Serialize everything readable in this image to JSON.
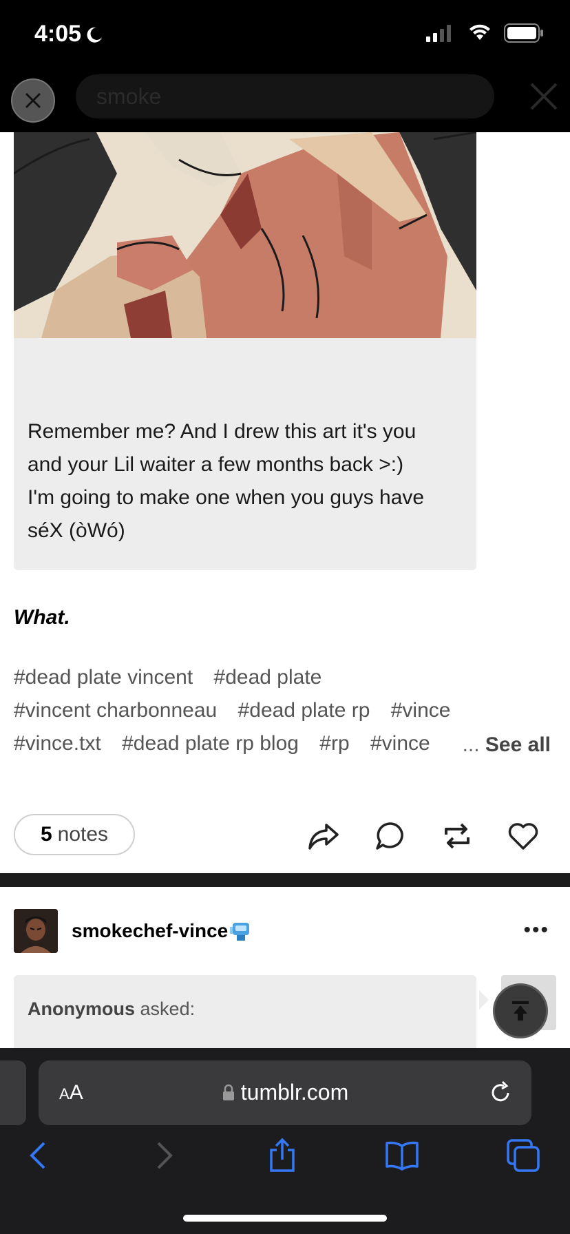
{
  "status": {
    "time": "4:05"
  },
  "search": {
    "query": "smoke"
  },
  "post1": {
    "ask_text": "Remember me? And I drew this art it's you and your Lil waiter a few months back >:) I'm going to make one when you guys have séX (òWó)",
    "ask_lines": [
      "Remember me? And I drew this art it's you",
      "and your Lil waiter a few months back >:)",
      "I'm going to make one when you guys have",
      "séX (òWó)"
    ],
    "reply": "What.",
    "tags_row1": [
      "#dead plate vincent",
      "#dead plate"
    ],
    "tags_row2": [
      "#vincent charbonneau",
      "#dead plate rp",
      "#vince"
    ],
    "tags_row3": [
      "#vince.txt",
      "#dead plate rp blog",
      "#rp",
      "#vince"
    ],
    "see_all": "See all",
    "see_all_dots": "...",
    "notes_count": "5",
    "notes_label": "notes"
  },
  "post2": {
    "blog_name": "smokechef-vince",
    "ask_from": "Anonymous",
    "ask_verb": "asked:",
    "more": "•••"
  },
  "browser": {
    "aa_big": "A",
    "aa_small": "A",
    "domain": "tumblr.com"
  },
  "colors": {
    "accent": "#3478f6",
    "tag_text": "#555555",
    "toolbar_bg": "#1c1c1e"
  }
}
